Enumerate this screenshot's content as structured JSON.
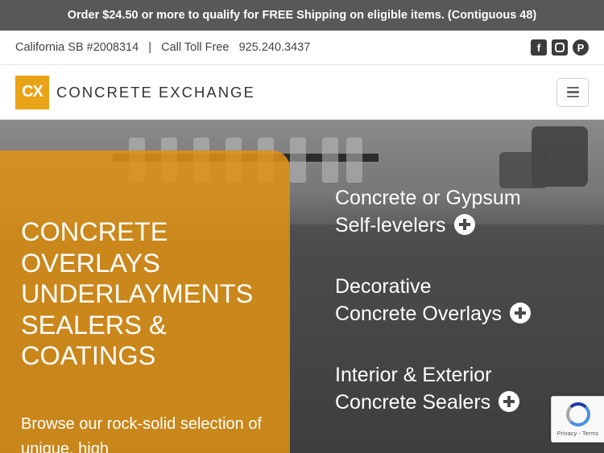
{
  "promo": {
    "text": "Order $24.50 or more to qualify for FREE Shipping on eligible items. (Contiguous 48)"
  },
  "info_bar": {
    "license": "California SB #2008314",
    "separator": "|",
    "call_label": "Call Toll Free",
    "phone": "925.240.3437",
    "social": [
      {
        "name": "facebook-icon",
        "glyph": "f"
      },
      {
        "name": "instagram-icon"
      },
      {
        "name": "pinterest-icon",
        "glyph": "P"
      }
    ]
  },
  "header": {
    "logo_text": "CX",
    "brand_name": "CONCRETE EXCHANGE",
    "menu_icon": "hamburger-menu-icon"
  },
  "hero": {
    "title_lines": [
      "CONCRETE",
      "OVERLAYS",
      "UNDERLAYMENTS",
      "SEALERS &",
      "COATINGS"
    ],
    "description": "Browse our rock-solid selection of unique, high",
    "links": [
      {
        "line1": "Concrete or Gypsum",
        "line2": "Self-levelers"
      },
      {
        "line1": "Decorative",
        "line2": "Concrete Overlays"
      },
      {
        "line1": "Interior & Exterior",
        "line2": "Concrete Sealers"
      }
    ]
  },
  "recaptcha": {
    "text": "Privacy - Terms"
  },
  "colors": {
    "accent": "#e09214",
    "promo_bg": "#58585a",
    "brand_orange": "#e8a317"
  }
}
